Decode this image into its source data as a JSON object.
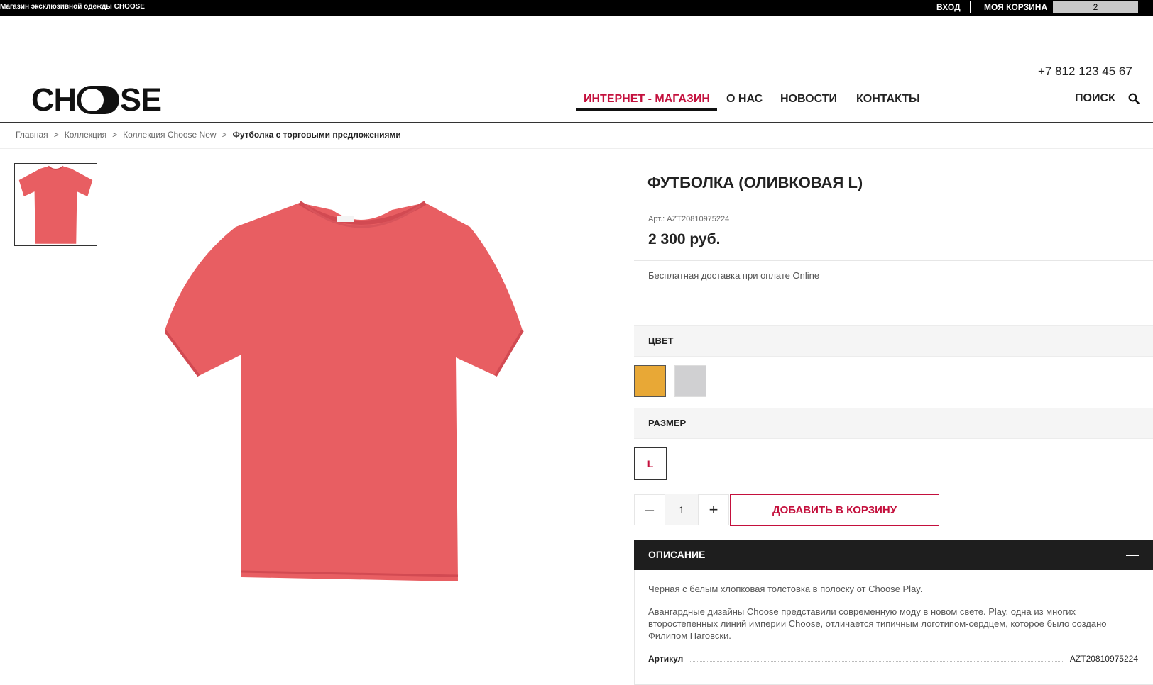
{
  "topbar": {
    "site_title": "Магазин эксклюзивной одежды CHOOSE",
    "login": "ВХОД",
    "cart_label": "МОЯ КОРЗИНА",
    "cart_count": "2"
  },
  "header": {
    "logo_left": "CH",
    "logo_right": "SE",
    "phone": "+7 812 123 45 67",
    "nav": [
      {
        "label": "ИНТЕРНЕТ - МАГАЗИН",
        "active": true
      },
      {
        "label": "О НАС",
        "active": false
      },
      {
        "label": "НОВОСТИ",
        "active": false
      },
      {
        "label": "КОНТАКТЫ",
        "active": false
      }
    ],
    "search_label": "ПОИСК"
  },
  "breadcrumb": {
    "sep": ">",
    "items": [
      "Главная",
      "Коллекция",
      "Коллекция Choose New",
      "Футболка с торговыми предложениями"
    ]
  },
  "product": {
    "title": "ФУТБОЛКА (ОЛИВКОВАЯ L)",
    "article_label": "Арт.: AZT20810975224",
    "price": "2 300 руб.",
    "delivery": "Бесплатная доставка при оплате Online",
    "tshirt_color": "#e85e62"
  },
  "color_section": {
    "title": "ЦВЕТ",
    "swatches": [
      {
        "color": "#e8a836",
        "selected": true
      },
      {
        "color": "#d0d0d2",
        "selected": false
      }
    ]
  },
  "size_section": {
    "title": "РАЗМЕР",
    "selected": "L"
  },
  "quantity": {
    "minus": "–",
    "value": "1",
    "plus": "+"
  },
  "add_to_cart": "ДОБАВИТЬ В КОРЗИНУ",
  "description": {
    "title": "ОПИСАНИЕ",
    "collapse": "—",
    "p1": "Черная с белым хлопковая толстовка в полоску от Choose Play.",
    "p2": "Авангардные дизайны Choose представили современную моду в новом свете. Play, одна из многих второстепенных линий империи Choose, отличается типичным логотипом-сердцем, которое было создано Филипом Паговски.",
    "article_key": "Артикул",
    "article_value": "AZT20810975224"
  }
}
